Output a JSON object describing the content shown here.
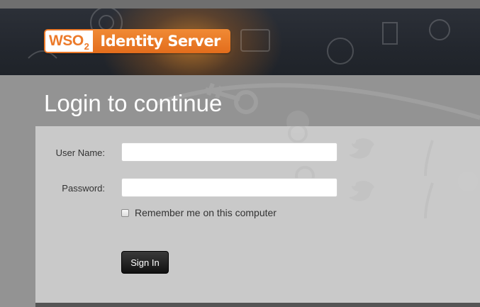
{
  "header": {
    "logo_wso": "WSO",
    "logo_sub": "2",
    "product_name": "Identity Server"
  },
  "page_title": "Login to continue",
  "form": {
    "username_label": "User Name:",
    "username_value": "",
    "password_label": "Password:",
    "password_value": "",
    "remember_label": "Remember me on this computer",
    "remember_checked": false,
    "signin_label": "Sign In"
  },
  "colors": {
    "brand_orange": "#ec7a2a",
    "header_dark": "#23272e",
    "page_gray": "#939393",
    "panel_gray": "#cdcdcd",
    "button_dark": "#111111"
  }
}
